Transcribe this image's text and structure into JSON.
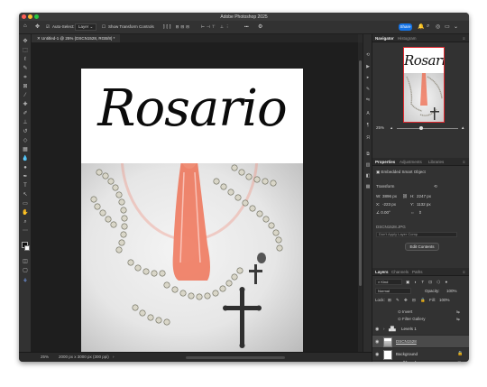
{
  "window": {
    "title": "Adobe Photoshop 2025",
    "traffic_colors": [
      "#ff5f57",
      "#febc2e",
      "#28c840"
    ]
  },
  "options_bar": {
    "auto_select_label": "Auto-Select:",
    "auto_select_value": "Layer",
    "transform_controls_label": "Show Transform Controls",
    "more_label": "•••",
    "share_label": "Share"
  },
  "document_tab": {
    "label": "Untitled-1 @ 25% (DSCN1528, RGB/8) *"
  },
  "canvas": {
    "title_text": "Rosario"
  },
  "status_bar": {
    "zoom": "25%",
    "dimensions": "2000 px x 3000 px (300 ppi)"
  },
  "navigator": {
    "tabs": [
      "Navigator",
      "Histogram"
    ],
    "preview_text": "Rosario",
    "zoom_value": "25%"
  },
  "properties": {
    "tabs": [
      "Properties",
      "Adjustments",
      "Libraries"
    ],
    "object_type": "Embedded Smart Object",
    "section_transform": "Transform",
    "w_label": "W:",
    "w_value": "3896 px",
    "h_label": "H:",
    "h_value": "2247 px",
    "x_label": "X:",
    "x_value": "-223 px",
    "y_label": "Y:",
    "y_value": "1132 px",
    "angle_value": "0.00°",
    "filename": "DSCN1528.JPG",
    "layer_comp_placeholder": "Don't Apply Layer Comp",
    "edit_contents_label": "Edit Contents"
  },
  "layers": {
    "tabs": [
      "Layers",
      "Channels",
      "Paths"
    ],
    "kind_label": "Kind",
    "blend_mode": "Normal",
    "opacity_label": "Opacity:",
    "opacity_value": "100%",
    "lock_label": "Lock:",
    "fill_label": "Fill:",
    "fill_value": "100%",
    "sub_invert": "Invert",
    "sub_filter_gallery": "Filter Gallery",
    "items": [
      {
        "name": "Levels 1"
      },
      {
        "name": "DSCN1528"
      },
      {
        "name": "Background"
      }
    ]
  }
}
